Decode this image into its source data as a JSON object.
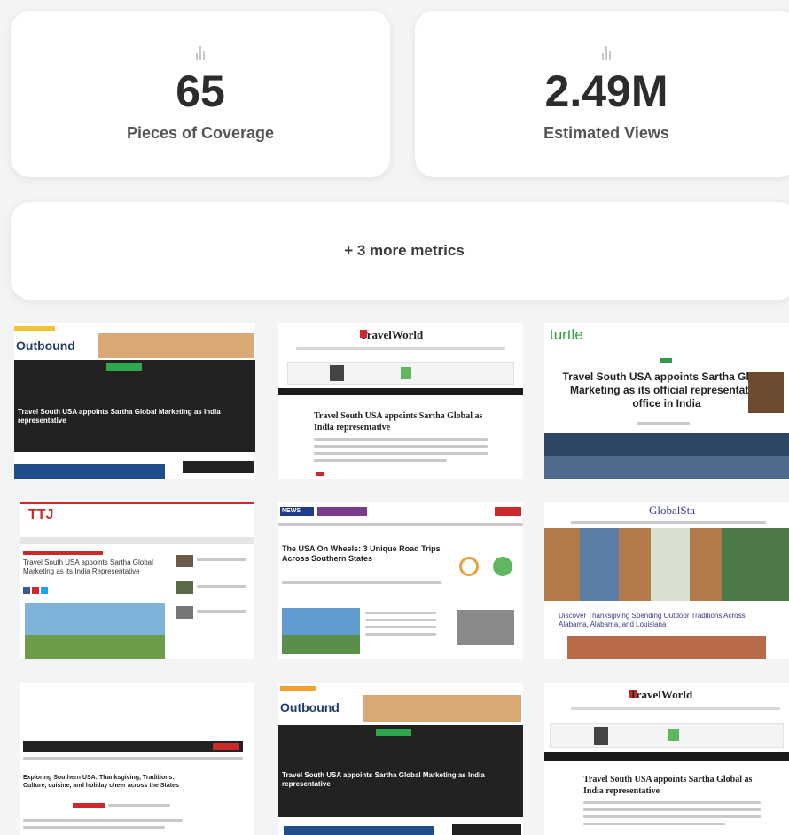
{
  "metrics": [
    {
      "value": "65",
      "label": "Pieces of Coverage",
      "icon": "bar-chart-icon"
    },
    {
      "value": "2.49M",
      "label": "Estimated Views",
      "icon": "bar-chart-icon"
    }
  ],
  "more_metrics": {
    "label": "+ 3 more metrics"
  },
  "thumbnails": [
    {
      "brand": "Outbound",
      "headline": "Travel South USA appoints Sartha Global Marketing as India representative"
    },
    {
      "brand": "TravelWorld",
      "headline": "Travel South USA appoints Sartha Global as India representative"
    },
    {
      "brand": "turtle",
      "headline": "Travel South USA appoints Sartha Global Marketing as its official representative office in India"
    },
    {
      "brand": "TTJ",
      "headline": "Travel South USA appoints Sartha Global Marketing as its India Representative"
    },
    {
      "brand": "NEWS",
      "headline": "The USA On Wheels: 3 Unique Road Trips Across Southern States"
    },
    {
      "brand": "GlobalSta",
      "headline": "Discover Thanksgiving Spending Outdoor Traditions Across Alabama, Alabama, and Louisiana"
    },
    {
      "brand": "",
      "headline": "Exploring Southern USA: Thanksgiving, Traditions: Culture, cuisine, and holiday cheer across the States"
    },
    {
      "brand": "Outbound",
      "headline": "Travel South USA appoints Sartha Global Marketing as India representative"
    },
    {
      "brand": "TravelWorld",
      "headline": "Travel South USA appoints Sartha Global as India representative"
    }
  ]
}
